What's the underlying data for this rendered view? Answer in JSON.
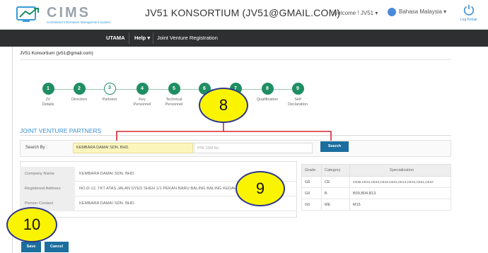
{
  "header": {
    "logo_name": "CIMS",
    "logo_tagline": "Centralised Information Management System",
    "title": "JV51 KONSORTIUM (JV51@GMAIL.COM)",
    "welcome": "Welcome ! JV51 ▾",
    "language": "Bahasa Malaysia ▾",
    "logout": "Log Keluar"
  },
  "nav": {
    "items": [
      "UTAMA",
      "Help ▾",
      "Joint Venture Registration"
    ]
  },
  "account_label": "JV51 Konsortium (jv51@gmail.com)",
  "steps": [
    {
      "num": "1",
      "label": "JV\nDetails",
      "state": "done"
    },
    {
      "num": "2",
      "label": "Directors",
      "state": "done"
    },
    {
      "num": "3",
      "label": "Partners",
      "state": "current"
    },
    {
      "num": "4",
      "label": "Key\nPersonnel",
      "state": "done"
    },
    {
      "num": "5",
      "label": "Technical\nPersonnel",
      "state": "done"
    },
    {
      "num": "6",
      "label": "Co...",
      "state": "done"
    },
    {
      "num": "7",
      "label": "",
      "state": "done"
    },
    {
      "num": "8",
      "label": "Qualification",
      "state": "done"
    },
    {
      "num": "9",
      "label": "Self\nDeclaration",
      "state": "done"
    }
  ],
  "section": {
    "title": "JOINT VENTURE PARTNERS"
  },
  "search": {
    "label": "Search By :",
    "company_value": "KEMBARA DAMAI SDN. BHD.",
    "ssm_placeholder": "PPK SSM No.",
    "button": "Search"
  },
  "company": {
    "rows": [
      {
        "key": "Company Name",
        "value": "KEMBARA DAMAI SDN. BHD."
      },
      {
        "key": "Registered Address",
        "value": "NO.D-12, TKT ATAS JALAN SYED SHEH 1/1 PEKAN BARU BALING BALING KEDAH"
      },
      {
        "key": "Person Contact",
        "value": "KEMBARA DAMAI SDN. BHD."
      }
    ]
  },
  "grades": {
    "headers": [
      "Grade",
      "Category",
      "Specialization"
    ],
    "rows": [
      [
        "G6",
        "CE",
        "CE36,CE31,CE42,CE43,CE01,CE14,CE34,CE21,CE10"
      ],
      [
        "G6",
        "B",
        "B09,B04,B13"
      ],
      [
        "G6",
        "ME",
        "M15"
      ]
    ]
  },
  "actions": {
    "save": "Save",
    "cancel": "Cancel"
  },
  "annotations": {
    "callout_search": "8",
    "callout_details": "9",
    "callout_save": "10",
    "highlight_color": "#fbf400",
    "border_color": "#2d3691",
    "bracket_color": "#d9272e"
  },
  "colors": {
    "step_green": "#1f8f63",
    "accent_blue": "#3a8fd2",
    "button_blue": "#1b6e9e",
    "nav_dark": "#2e2f31"
  }
}
